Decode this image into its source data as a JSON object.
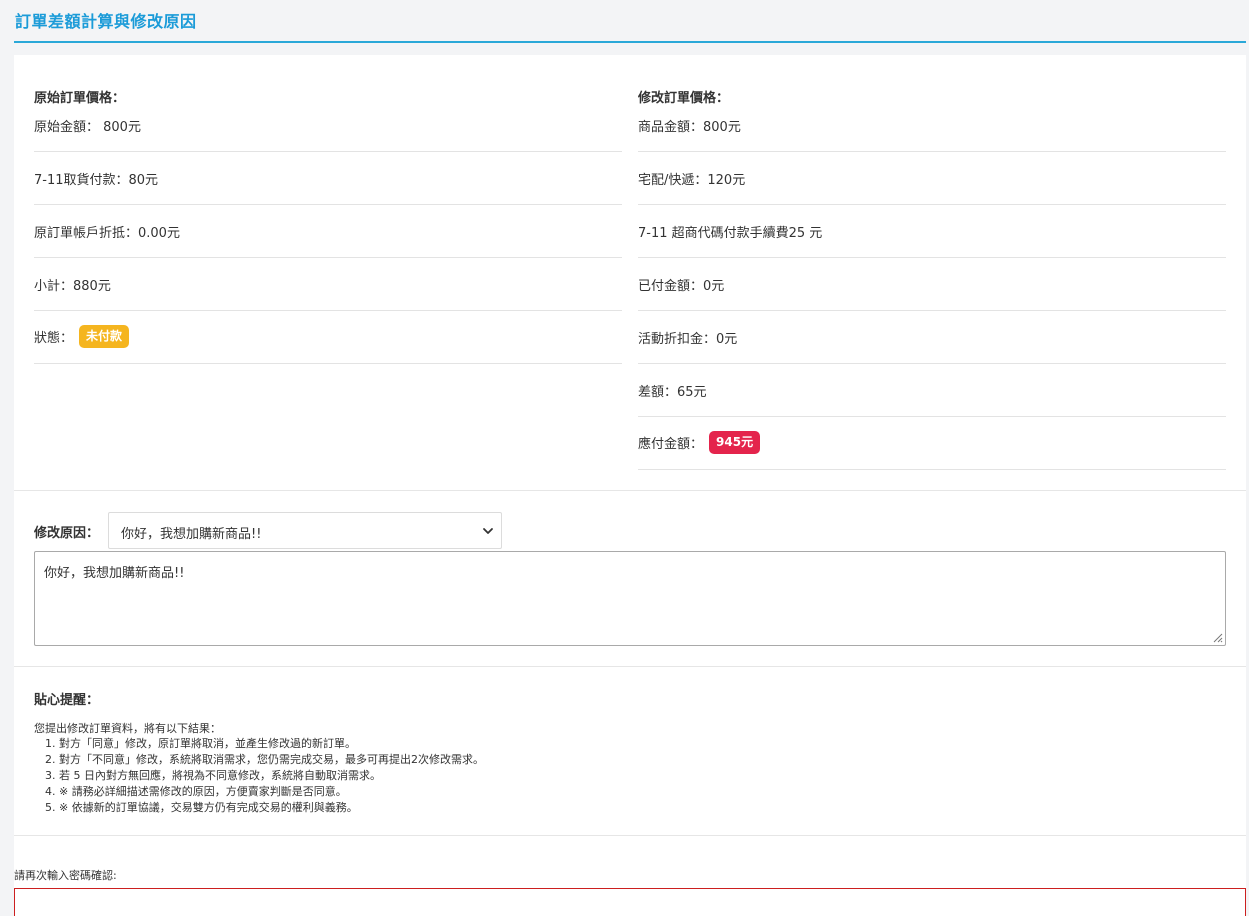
{
  "page": {
    "title": "訂單差額計算與修改原因"
  },
  "original": {
    "heading": "原始訂單價格：",
    "rows": [
      "原始金額： 800元",
      "7-11取貨付款：80元",
      "原訂單帳戶折抵：0.00元",
      "小計：880元"
    ],
    "status_label": "狀態：",
    "status_badge": "未付款"
  },
  "modified": {
    "heading": "修改訂單價格：",
    "rows": [
      "商品金額：800元",
      "宅配/快遞：120元",
      "7-11 超商代碼付款手續費25 元",
      "已付金額：0元",
      "活動折扣金：0元",
      "差額：65元"
    ],
    "payable_label": "應付金額：",
    "payable_badge": "945元"
  },
  "reason": {
    "label": "修改原因：",
    "selected": "你好，我想加購新商品!!",
    "text": "你好，我想加購新商品!!"
  },
  "tips": {
    "heading": "貼心提醒：",
    "intro": "您提出修改訂單資料，將有以下結果：",
    "items": [
      "1. 對方「同意」修改，原訂單將取消，並產生修改過的新訂單。",
      "2. 對方「不同意」修改，系統將取消需求，您仍需完成交易，最多可再提出2次修改需求。",
      "3. 若 5 日內對方無回應，將視為不同意修改，系統將自動取消需求。",
      "4. ※ 請務必詳細描述需修改的原因，方便賣家判斷是否同意。",
      "5. ※ 依據新的訂單協議，交易雙方仍有完成交易的權利與義務。"
    ]
  },
  "password": {
    "label": "請再次輸入密碼確認:",
    "value": ""
  },
  "colors": {
    "accent": "#2aa8d8",
    "title": "#1b9bd8",
    "badge_unpaid": "#f5b51f",
    "badge_payable": "#e4244c",
    "error_border": "#cc1f1f"
  },
  "icons": {
    "select_arrow": "chevron-down-icon",
    "resize": "resize-grip-icon"
  }
}
